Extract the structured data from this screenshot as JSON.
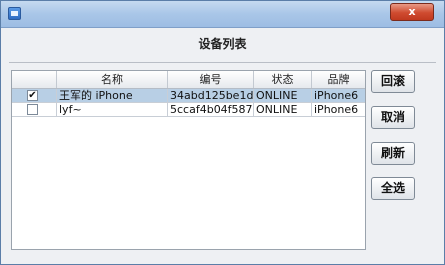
{
  "window": {
    "close_glyph": "x"
  },
  "header": {
    "title": "设备列表"
  },
  "table": {
    "columns": [
      "",
      "名称",
      "编号",
      "状态",
      "品牌"
    ],
    "rows": [
      {
        "checked": true,
        "check_glyph": "✔",
        "name": "王军的 iPhone",
        "id": "34abd125be1d...",
        "status": "ONLINE",
        "brand": "iPhone6"
      },
      {
        "checked": false,
        "check_glyph": "",
        "name": "lyf~",
        "id": "5ccaf4b04f587...",
        "status": "ONLINE",
        "brand": "iPhone6"
      }
    ]
  },
  "buttons": {
    "back": "回滚",
    "cancel": "取消",
    "refresh": "刷新",
    "select_all": "全选"
  },
  "colors": {
    "selection": "#b8cfe5",
    "title_gradient": "#a9c6e8",
    "close": "#cf4b30"
  }
}
